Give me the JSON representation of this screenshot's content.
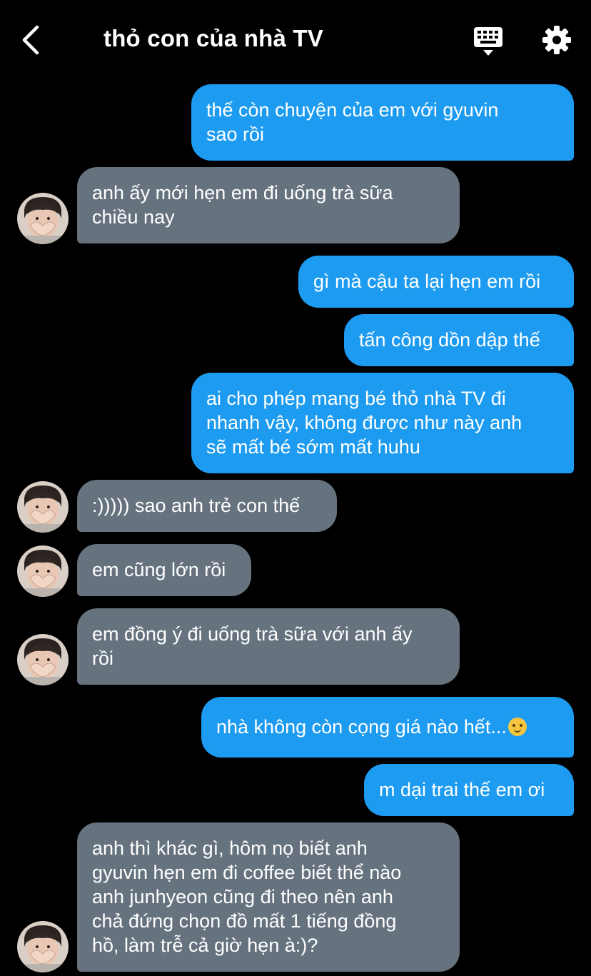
{
  "header": {
    "title": "thỏ con của nhà TV",
    "icons": [
      "chevron-left-icon",
      "keyboard-icon",
      "gear-icon"
    ]
  },
  "messages": [
    {
      "dir": "out",
      "text": "thế còn chuyện của em với gyuvin\nsao rồi"
    },
    {
      "dir": "in",
      "text": "anh ấy mới hẹn em đi uống trà sữa\nchiều nay"
    },
    {
      "dir": "out",
      "text": "gì mà cậu ta lại hẹn em rồi"
    },
    {
      "dir": "out",
      "text": "tấn công dồn dập thế"
    },
    {
      "dir": "out",
      "text": "ai cho phép mang bé thỏ nhà TV đi\nnhanh vậy, không được như này anh\nsẽ mất bé sớm mất huhu"
    },
    {
      "dir": "in",
      "text": ":))))) sao anh trẻ con thế"
    },
    {
      "dir": "in",
      "text": "em cũng lớn rồi"
    },
    {
      "dir": "in",
      "text": "em đồng ý đi uống trà sữa với anh ấy\nrồi"
    },
    {
      "dir": "out",
      "text": "nhà không còn cọng giá nào hết...",
      "emoji": "face-holding-back-tears-icon"
    },
    {
      "dir": "out",
      "text": "m dại trai thế em ơi"
    },
    {
      "dir": "in",
      "text": "anh thì khác gì, hôm nọ biết anh\ngyuvin hẹn em đi coffee biết thể nào\nanh junhyeon cũng đi theo nên anh\nchả đứng chọn đồ mất 1 tiếng đồng\nhồ, làm trễ cả giờ hẹn à:)?"
    }
  ],
  "colors": {
    "outgoing": "#1d9bf0",
    "incoming": "#66737f",
    "background": "#000000"
  }
}
